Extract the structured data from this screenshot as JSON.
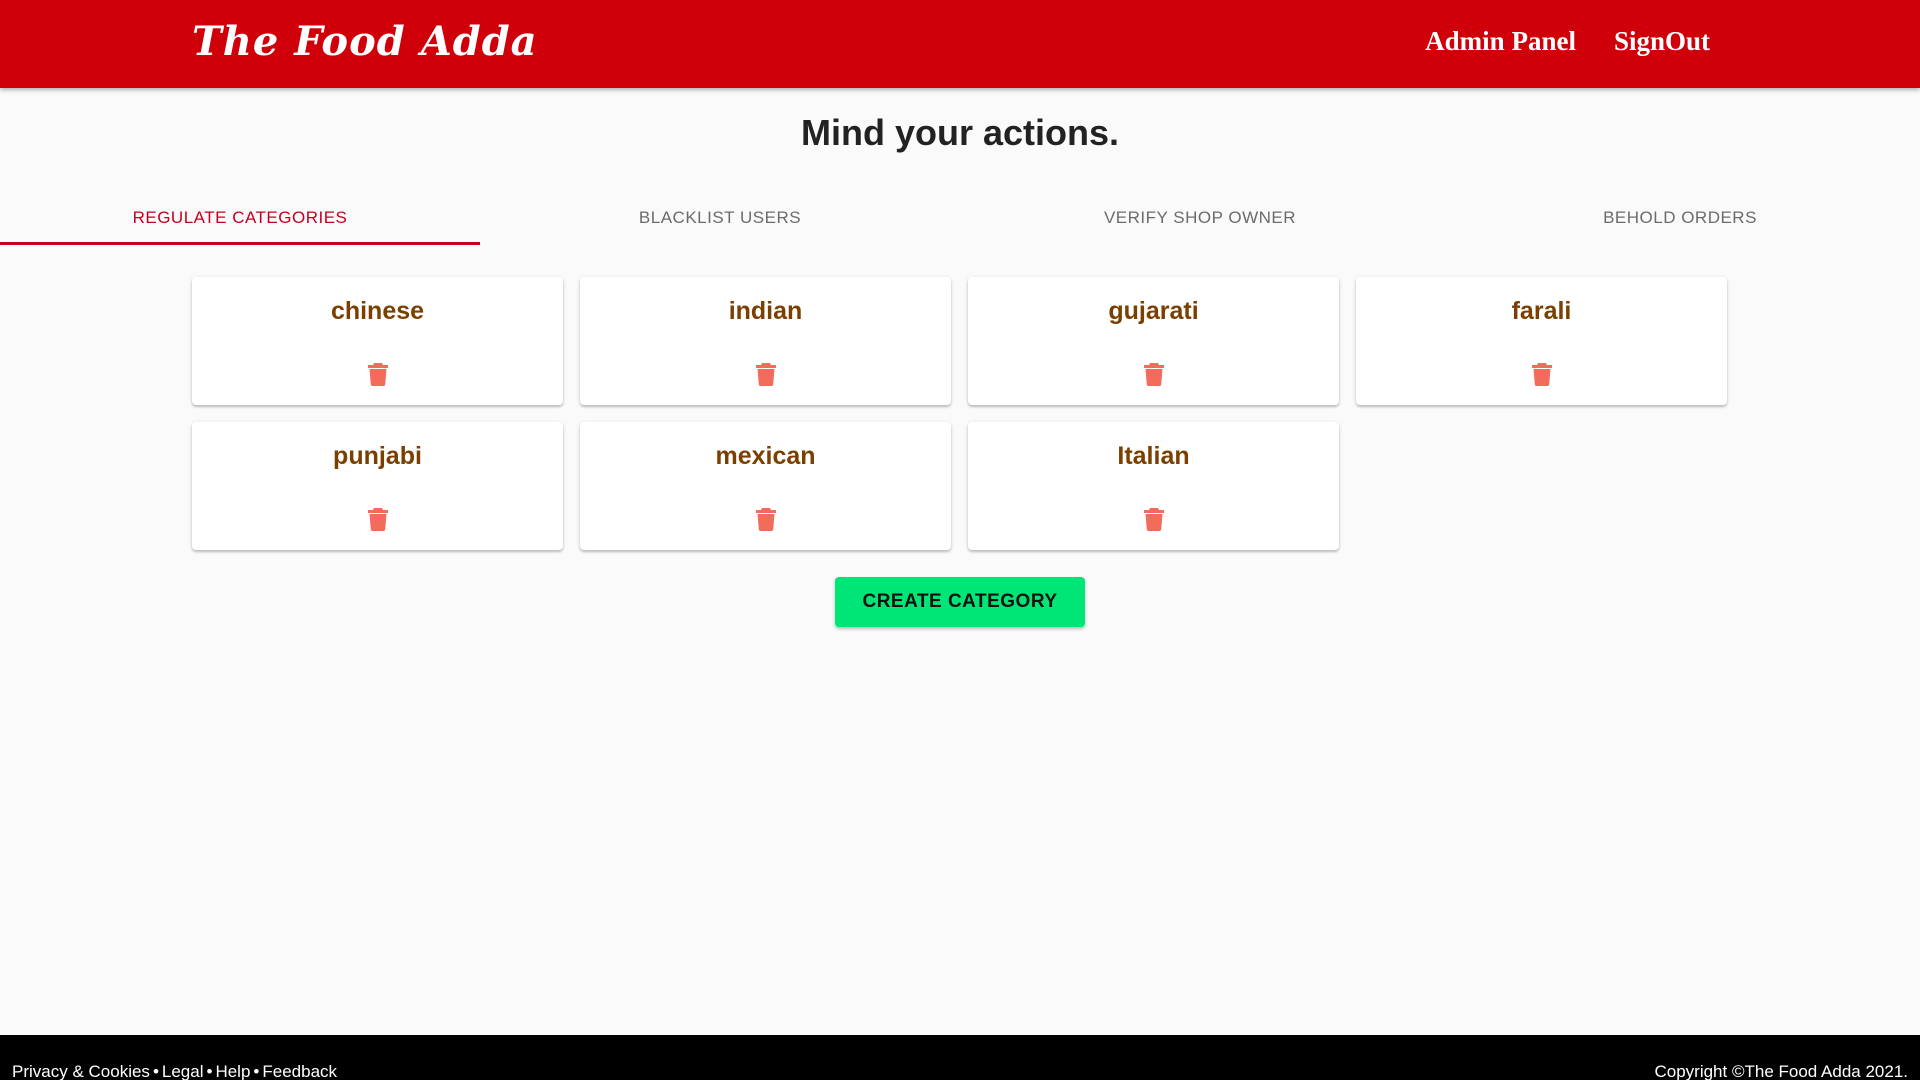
{
  "header": {
    "logo": "The Food Adda",
    "nav": [
      "Admin Panel",
      "SignOut"
    ],
    "background_color": "#d0000b"
  },
  "page": {
    "title": "Mind your actions."
  },
  "tabs": [
    {
      "label": "REGULATE CATEGORIES",
      "active": true
    },
    {
      "label": "BLACKLIST USERS",
      "active": false
    },
    {
      "label": "VERIFY SHOP OWNER",
      "active": false
    },
    {
      "label": "BEHOLD ORDERS",
      "active": false
    }
  ],
  "categories": [
    {
      "name": "chinese",
      "icon": "trash-icon"
    },
    {
      "name": "indian",
      "icon": "trash-icon"
    },
    {
      "name": "gujarati",
      "icon": "trash-icon"
    },
    {
      "name": "farali",
      "icon": "trash-icon"
    },
    {
      "name": "punjabi",
      "icon": "trash-icon"
    },
    {
      "name": "mexican",
      "icon": "trash-icon"
    },
    {
      "name": "Italian",
      "icon": "trash-icon"
    }
  ],
  "actions": {
    "create_label": "CREATE CATEGORY",
    "create_color": "#00e676"
  },
  "footer": {
    "links": [
      "Privacy & Cookies",
      "Legal",
      "Help",
      "Feedback"
    ],
    "separator": "•",
    "copyright": "Copyright ©The Food Adda 2021."
  },
  "colors": {
    "accent": "#c5001f",
    "category_text": "#7b3f00",
    "delete_icon": "#f26b5b"
  }
}
